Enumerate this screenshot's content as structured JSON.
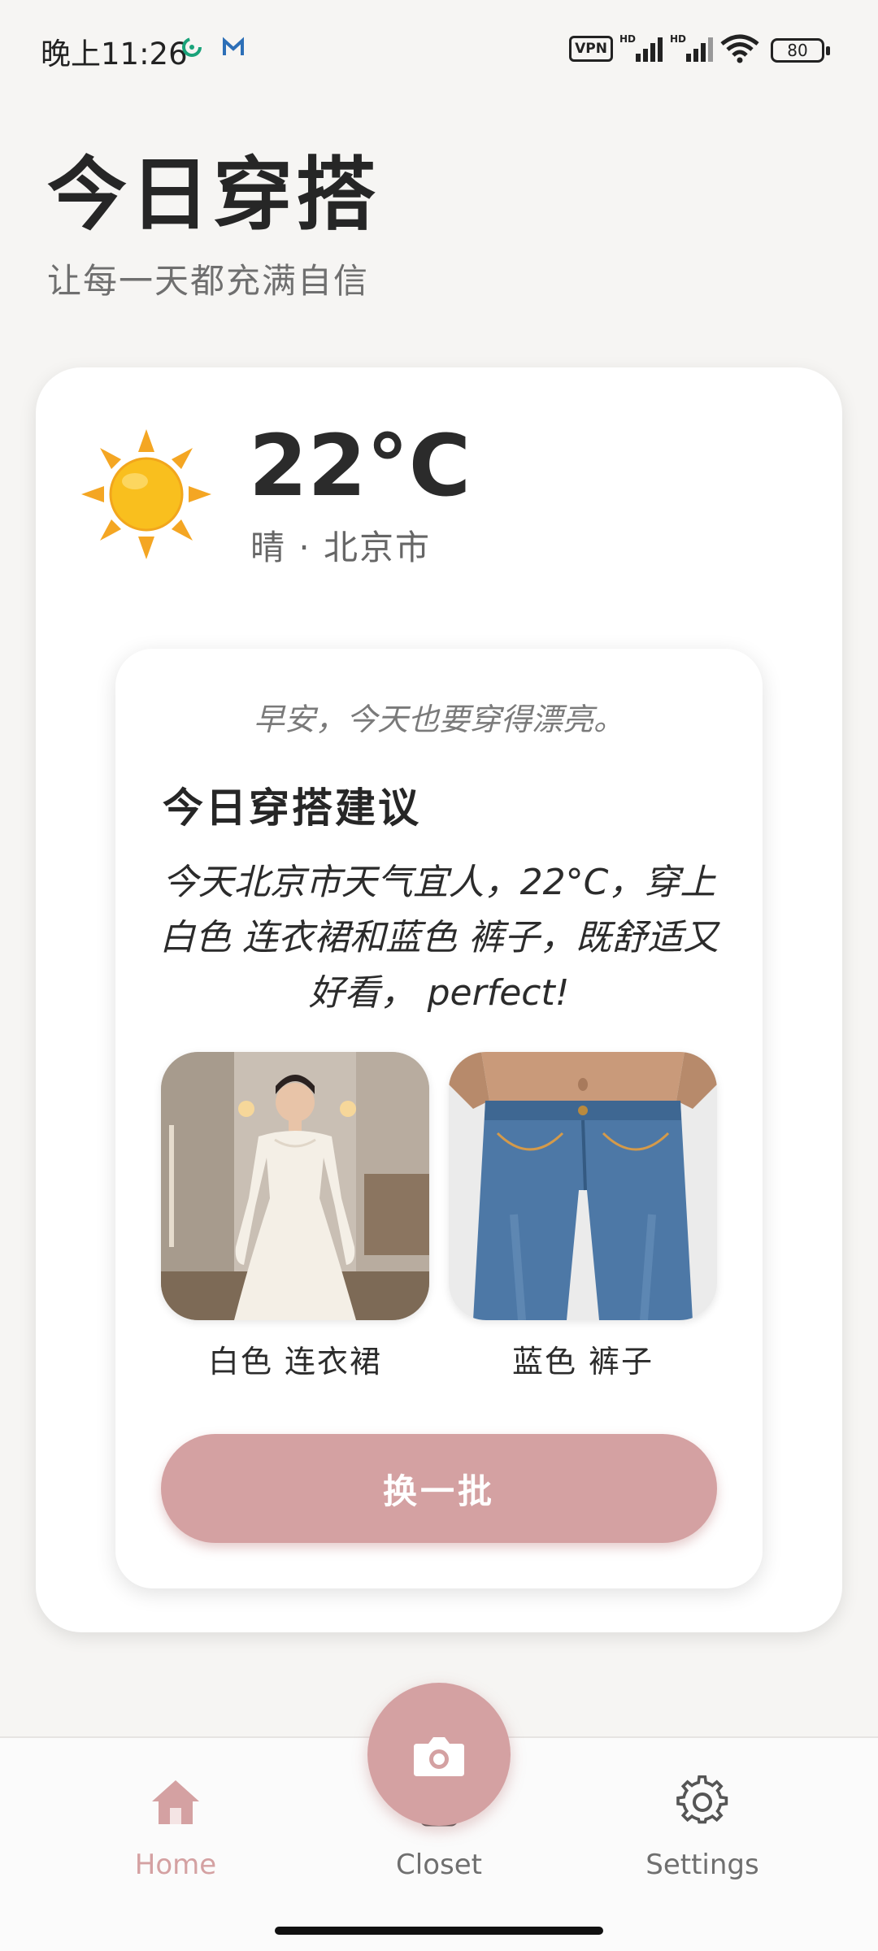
{
  "status_bar": {
    "time": "晚上11:26",
    "vpn": "VPN",
    "battery": "80",
    "app_icons": [
      "refresh-circle-icon",
      "m-logo-icon"
    ],
    "signal_icons": [
      "hd-signal-icon",
      "hd-signal-icon"
    ],
    "wifi_icon": "wifi-icon"
  },
  "header": {
    "title": "今日穿搭",
    "subtitle": "让每一天都充满自信"
  },
  "weather": {
    "icon": "sun-icon",
    "temperature": "22°C",
    "description": "晴 · 北京市"
  },
  "suggestion": {
    "greeting": "早安，今天也要穿得漂亮。",
    "title": "今日穿搭建议",
    "text": "今天北京市天气宜人，22°C，穿上白色 连衣裙和蓝色 裤子，既舒适又好看， perfect!",
    "items": [
      {
        "label": "白色 连衣裙",
        "image": "white-dress-photo"
      },
      {
        "label": "蓝色 裤子",
        "image": "blue-jeans-photo"
      }
    ],
    "refresh_label": "换一批"
  },
  "bottom_nav": {
    "items": [
      {
        "label": "Home",
        "icon": "home-icon",
        "active": true
      },
      {
        "label": "Closet",
        "icon": "closet-icon",
        "active": false
      },
      {
        "label": "Settings",
        "icon": "gear-icon",
        "active": false
      }
    ],
    "fab_icon": "camera-icon"
  },
  "colors": {
    "accent": "#d4a1a2",
    "background": "#f6f5f3",
    "card": "#ffffff",
    "text_primary": "#262626",
    "text_secondary": "#6f6f6f"
  }
}
